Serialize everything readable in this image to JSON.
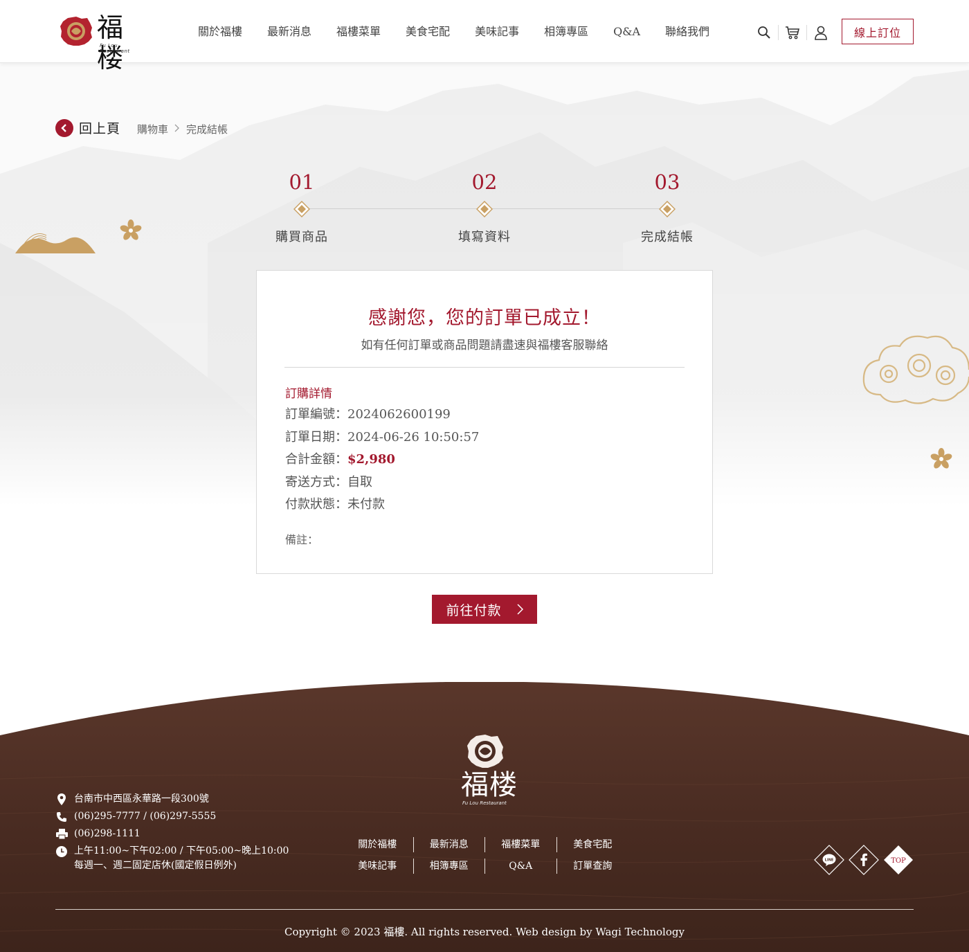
{
  "header": {
    "logo_text": "福楼",
    "logo_sub": "Fu Lou Restaurant",
    "nav": [
      "關於福樓",
      "最新消息",
      "福樓菜單",
      "美食宅配",
      "美味記事",
      "相簿專區",
      "Q&A",
      "聯絡我們"
    ],
    "icons": [
      "search-icon",
      "cart-icon",
      "user-icon"
    ],
    "book_button": "線上訂位"
  },
  "breadcrumb": {
    "back_label": "回上頁",
    "items": [
      "購物車",
      "完成結帳"
    ]
  },
  "steps": [
    {
      "num": "01",
      "label": "購買商品"
    },
    {
      "num": "02",
      "label": "填寫資料"
    },
    {
      "num": "03",
      "label": "完成結帳"
    }
  ],
  "order": {
    "title": "感謝您，您的訂單已成立！",
    "subtitle": "如有任何訂單或商品問題請盡速與福樓客服聯絡",
    "detail_heading": "訂購詳情",
    "number_label": "訂單編號：",
    "number": "2024062600199",
    "date_label": "訂單日期：",
    "date": "2024-06-26 10:50:57",
    "total_label": "合計金額：",
    "total": "$2,980",
    "shipping_label": "寄送方式：",
    "shipping": "自取",
    "payment_label": "付款狀態：",
    "payment": "未付款",
    "note_label": "備註："
  },
  "pay_button": "前往付款",
  "footer": {
    "logo_text": "福楼",
    "logo_sub": "Fu Lou Restaurant",
    "address": "台南市中西區永華路一段300號",
    "phone": "(06)295-7777 / (06)297-5555",
    "fax": "(06)298-1111",
    "hours": "上午11:00~下午02:00 / 下午05:00~晚上10:00",
    "closed": "每週一、週二固定店休(國定假日例外)",
    "links_row1": [
      "關於福樓",
      "最新消息",
      "福樓菜單",
      "美食宅配"
    ],
    "links_row2": [
      "美味記事",
      "相簿專區",
      "Q&A",
      "訂單查詢"
    ],
    "socials": [
      "line-icon",
      "facebook-icon",
      "top-button"
    ],
    "line_text": "LINE",
    "top_text": "TOP",
    "copyright": "Copyright © 2023 福樓. All rights reserved. Web design by Wagi Technology"
  },
  "colors": {
    "brand": "#a3192e",
    "gold": "#c9a063",
    "footer_wood": "#4a2c22"
  }
}
